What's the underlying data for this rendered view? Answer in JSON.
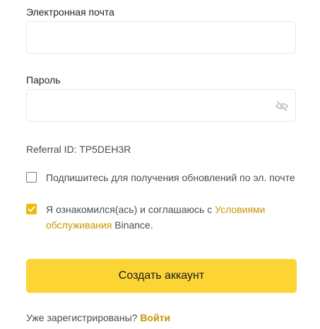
{
  "email": {
    "label": "Электронная почта",
    "value": ""
  },
  "password": {
    "label": "Пароль",
    "value": "",
    "toggle_icon": "eye-off-icon"
  },
  "referral": {
    "text": "Referral ID: TP5DEH3R"
  },
  "newsletter": {
    "checked": false,
    "label": "Подпишитесь для получения обновлений по эл. почте"
  },
  "terms": {
    "checked": true,
    "prefix": "Я ознакомился(ась) и соглашаюсь с ",
    "link_text": "Условиями обслуживания",
    "suffix": " Binance."
  },
  "submit": {
    "label": "Создать аккаунт"
  },
  "footer": {
    "prompt": "Уже зарегистрированы? ",
    "login_link": "Войти"
  },
  "colors": {
    "accent": "#fcd535",
    "link": "#c99400",
    "checkbox_checked": "#f0b90b",
    "text": "#1e2329",
    "secondary_text": "#474d57",
    "border": "#e6e8ea"
  }
}
